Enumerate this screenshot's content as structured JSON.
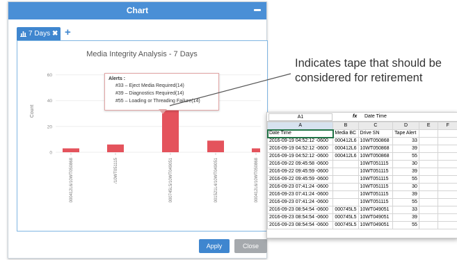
{
  "window": {
    "title": "Chart",
    "tab_label": "7 Days",
    "tab_close": "✖",
    "add_tab": "+",
    "apply_label": "Apply",
    "close_label": "Close"
  },
  "chart_data": {
    "type": "bar",
    "title": "Media Integrity Analysis - 7 Days",
    "ylabel": "Count",
    "ylim": [
      0,
      70
    ],
    "yticks": [
      0,
      20,
      40,
      60
    ],
    "categories": [
      "000412L6/10WT050868",
      "/10WT051115",
      "000745L5/10WT049051",
      "001521L4/10WT049051",
      "000412L6/10WT050868"
    ],
    "values": [
      3,
      6,
      42,
      9,
      3
    ],
    "bar_color": "#e4535c"
  },
  "tooltip": {
    "title": "Alerts :",
    "lines": [
      "#33 – Eject Media Required(14)",
      "#39 – Diagnostics Required(14)",
      "#55 – Loading or Threading Failure(14)"
    ]
  },
  "annotation": {
    "line1": "Indicates tape that should be",
    "line2": "considered for retirement"
  },
  "spreadsheet": {
    "name_box": "A1",
    "formula_icon": "fx",
    "formula_value": "Date Time",
    "columns": [
      "A",
      "B",
      "C",
      "D",
      "E",
      "F"
    ],
    "rows": [
      [
        "Date Time",
        "Media BC",
        "Drive SN",
        "Tape Alert"
      ],
      [
        "2016-09-19 04:52:12 -0600",
        "000412L6",
        "10WT050868",
        "33"
      ],
      [
        "2016-09-19 04:52:12 -0600",
        "000412L6",
        "10WT050868",
        "39"
      ],
      [
        "2016-09-19 04:52:12 -0600",
        "000412L6",
        "10WT050868",
        "55"
      ],
      [
        "2016-09-22 09:45:58 -0600",
        "",
        "10WT051115",
        "30"
      ],
      [
        "2016-09-22 09:45:59 -0600",
        "",
        "10WT051115",
        "39"
      ],
      [
        "2016-09-22 09:45:59 -0600",
        "",
        "10WT051115",
        "55"
      ],
      [
        "2016-09-23 07:41:24 -0600",
        "",
        "10WT051115",
        "30"
      ],
      [
        "2016-09-23 07:41:24 -0600",
        "",
        "10WT051115",
        "39"
      ],
      [
        "2016-09-23 07:41:24 -0600",
        "",
        "10WT051115",
        "55"
      ],
      [
        "2016-09-23 08:54:54 -0600",
        "000745L5",
        "10WT049051",
        "33"
      ],
      [
        "2016-09-23 08:54:54 -0600",
        "000745L5",
        "10WT049051",
        "39"
      ],
      [
        "2016-09-23 08:54:54 -0600",
        "000745L5",
        "10WT049051",
        "55"
      ]
    ]
  }
}
